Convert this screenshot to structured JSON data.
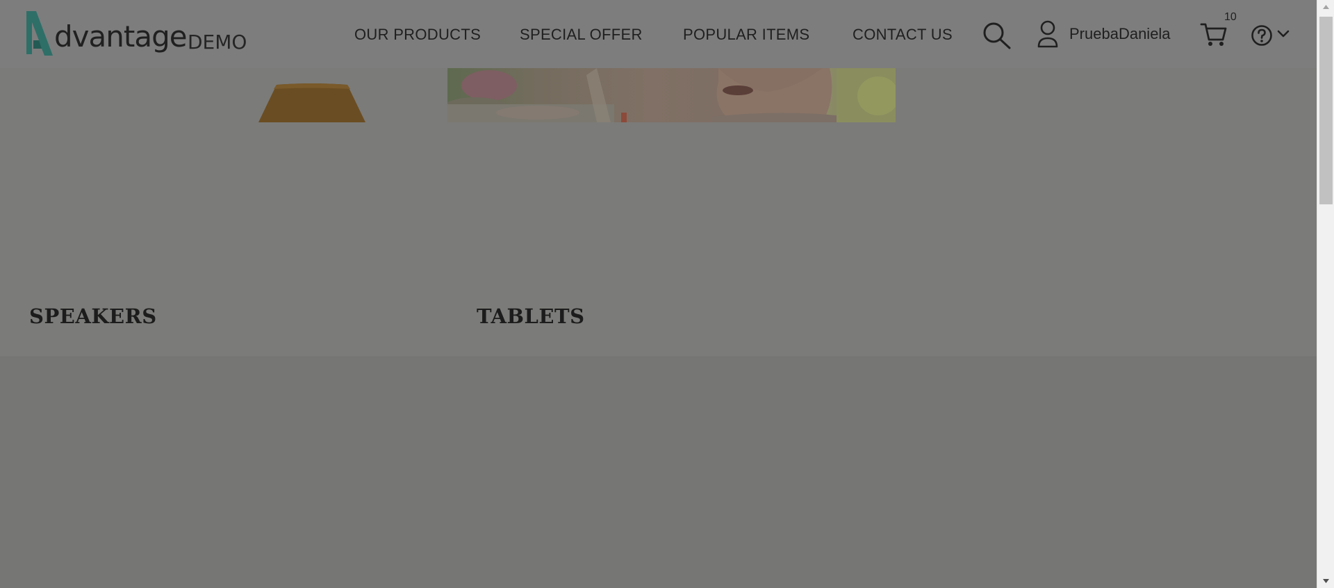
{
  "brand": {
    "word": "dvantage",
    "suffix": "DEMO",
    "accent": "#2e6f68"
  },
  "nav": {
    "items": [
      {
        "label": "OUR PRODUCTS"
      },
      {
        "label": "SPECIAL OFFER"
      },
      {
        "label": "POPULAR ITEMS"
      },
      {
        "label": "CONTACT US"
      }
    ]
  },
  "user": {
    "name": "PruebaDaniela"
  },
  "cart": {
    "count": "10"
  },
  "icons": {
    "search": "search-icon",
    "user": "user-icon",
    "cart": "cart-icon",
    "help": "help-icon",
    "chevron": "chevron-down-icon"
  },
  "categories": [
    {
      "title": "SPEAKERS"
    },
    {
      "title": "TABLETS"
    }
  ],
  "colors": {
    "overlay": "#7a7a78",
    "text": "#1f1f1f"
  }
}
